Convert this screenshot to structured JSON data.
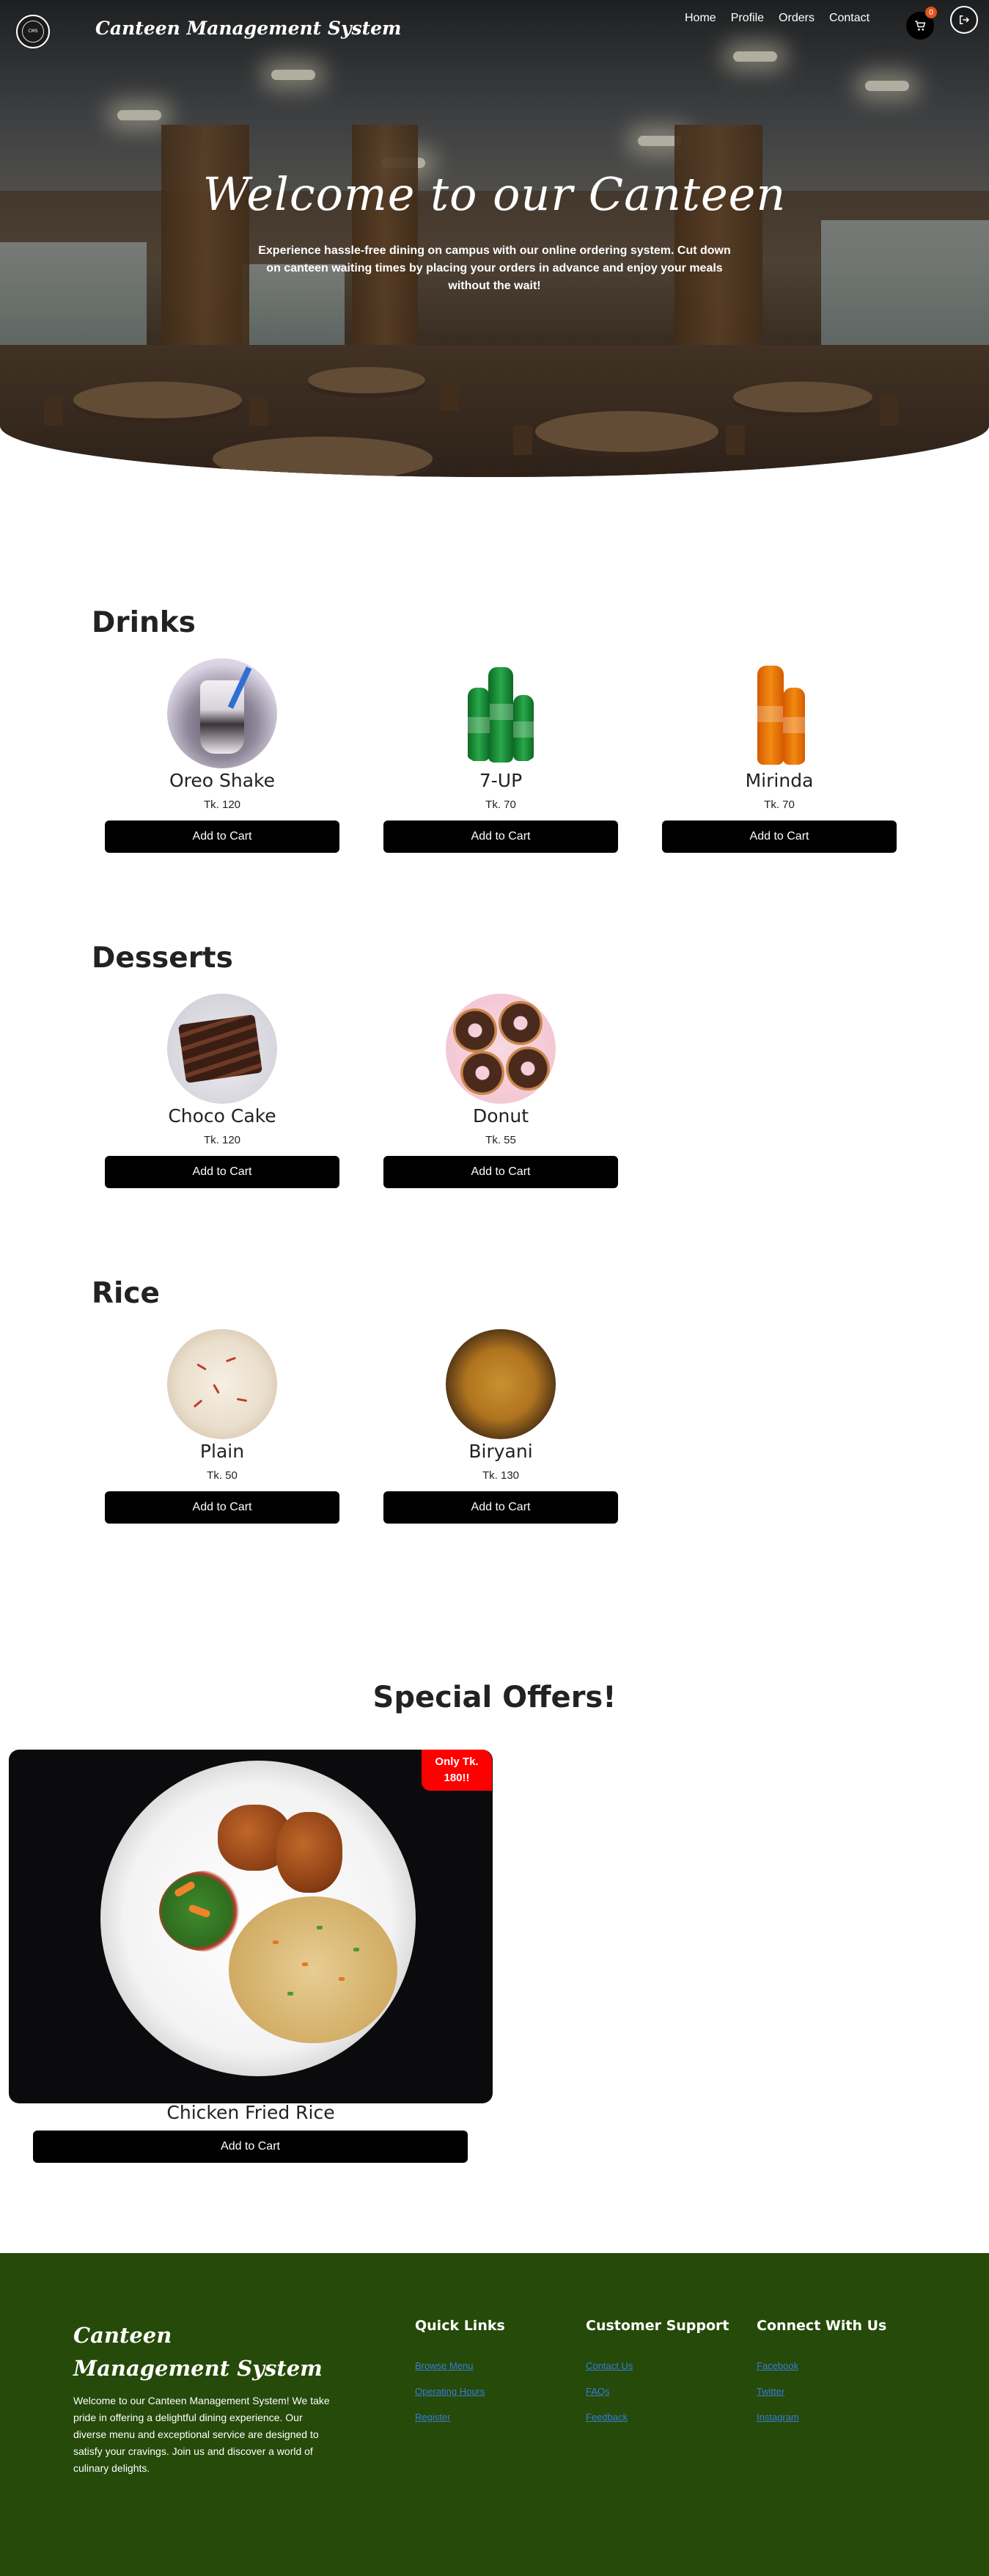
{
  "nav": {
    "logo_text": "CMS",
    "brand": "Canteen Management System",
    "links": [
      "Home",
      "Profile",
      "Orders",
      "Contact"
    ],
    "cart_count": "0",
    "cart_icon": "cart-icon",
    "logout_icon": "logout-icon"
  },
  "hero": {
    "title": "Welcome to our Canteen",
    "subtitle": "Experience hassle-free dining on campus with our online ordering system. Cut down on canteen waiting times by placing your orders in advance and enjoy your meals without the wait!"
  },
  "sections": [
    {
      "title": "Drinks",
      "items": [
        {
          "name": "Oreo Shake",
          "price": "Tk. 120",
          "button": "Add to Cart"
        },
        {
          "name": "7-UP",
          "price": "Tk. 70",
          "button": "Add to Cart"
        },
        {
          "name": "Mirinda",
          "price": "Tk. 70",
          "button": "Add to Cart"
        }
      ]
    },
    {
      "title": "Desserts",
      "items": [
        {
          "name": "Choco Cake",
          "price": "Tk. 120",
          "button": "Add to Cart"
        },
        {
          "name": "Donut",
          "price": "Tk. 55",
          "button": "Add to Cart"
        }
      ]
    },
    {
      "title": "Rice",
      "items": [
        {
          "name": "Plain",
          "price": "Tk. 50",
          "button": "Add to Cart"
        },
        {
          "name": "Biryani",
          "price": "Tk. 130",
          "button": "Add to Cart"
        }
      ]
    }
  ],
  "offers": {
    "title": "Special Offers!",
    "badge_line1": "Only Tk.",
    "badge_line2": "180!!",
    "item_name": "Chicken Fried Rice",
    "button": "Add to Cart"
  },
  "footer": {
    "brand": "Canteen Management System",
    "description": "Welcome to our Canteen Management System! We take pride in offering a delightful dining experience. Our diverse menu and exceptional service are designed to satisfy your cravings. Join us and discover a world of culinary delights.",
    "quick_links": {
      "title": "Quick Links",
      "links": [
        "Browse Menu",
        "Operating Hours",
        "Register"
      ]
    },
    "support": {
      "title": "Customer Support",
      "links": [
        "Contact Us",
        "FAQs",
        "Feedback"
      ]
    },
    "connect": {
      "title": "Connect With Us",
      "links": [
        "Facebook",
        "Twitter",
        "Instagram"
      ]
    }
  }
}
